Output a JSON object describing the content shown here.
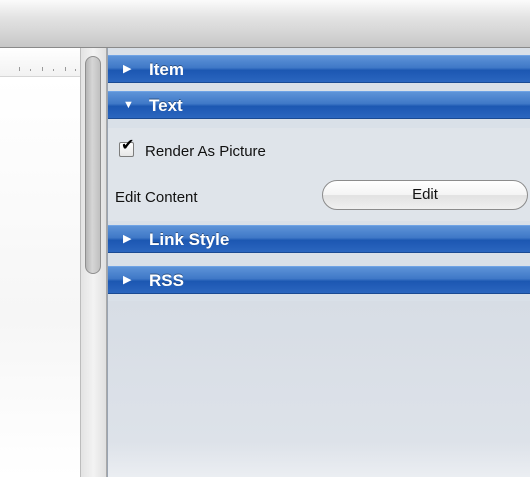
{
  "inspector": {
    "sections": [
      {
        "label": "Item",
        "expanded": false,
        "indicator": "▶"
      },
      {
        "label": "Text",
        "expanded": true,
        "indicator": "▼"
      },
      {
        "label": "Link Style",
        "expanded": false,
        "indicator": "▶"
      },
      {
        "label": "RSS",
        "expanded": false,
        "indicator": "▶"
      }
    ],
    "text_section": {
      "render_as_picture": {
        "label": "Render As Picture",
        "checked": true,
        "check_glyph": "✔"
      },
      "edit_content": {
        "label": "Edit Content",
        "button_label": "Edit"
      }
    }
  },
  "colors": {
    "section_header": "#2b66bf",
    "panel_background": "#d9e0e8",
    "header_text": "#ffffff"
  },
  "icons": {
    "collapsed": "disclosure-triangle-right-icon",
    "expanded": "disclosure-triangle-down-icon",
    "check": "checkmark-icon"
  }
}
